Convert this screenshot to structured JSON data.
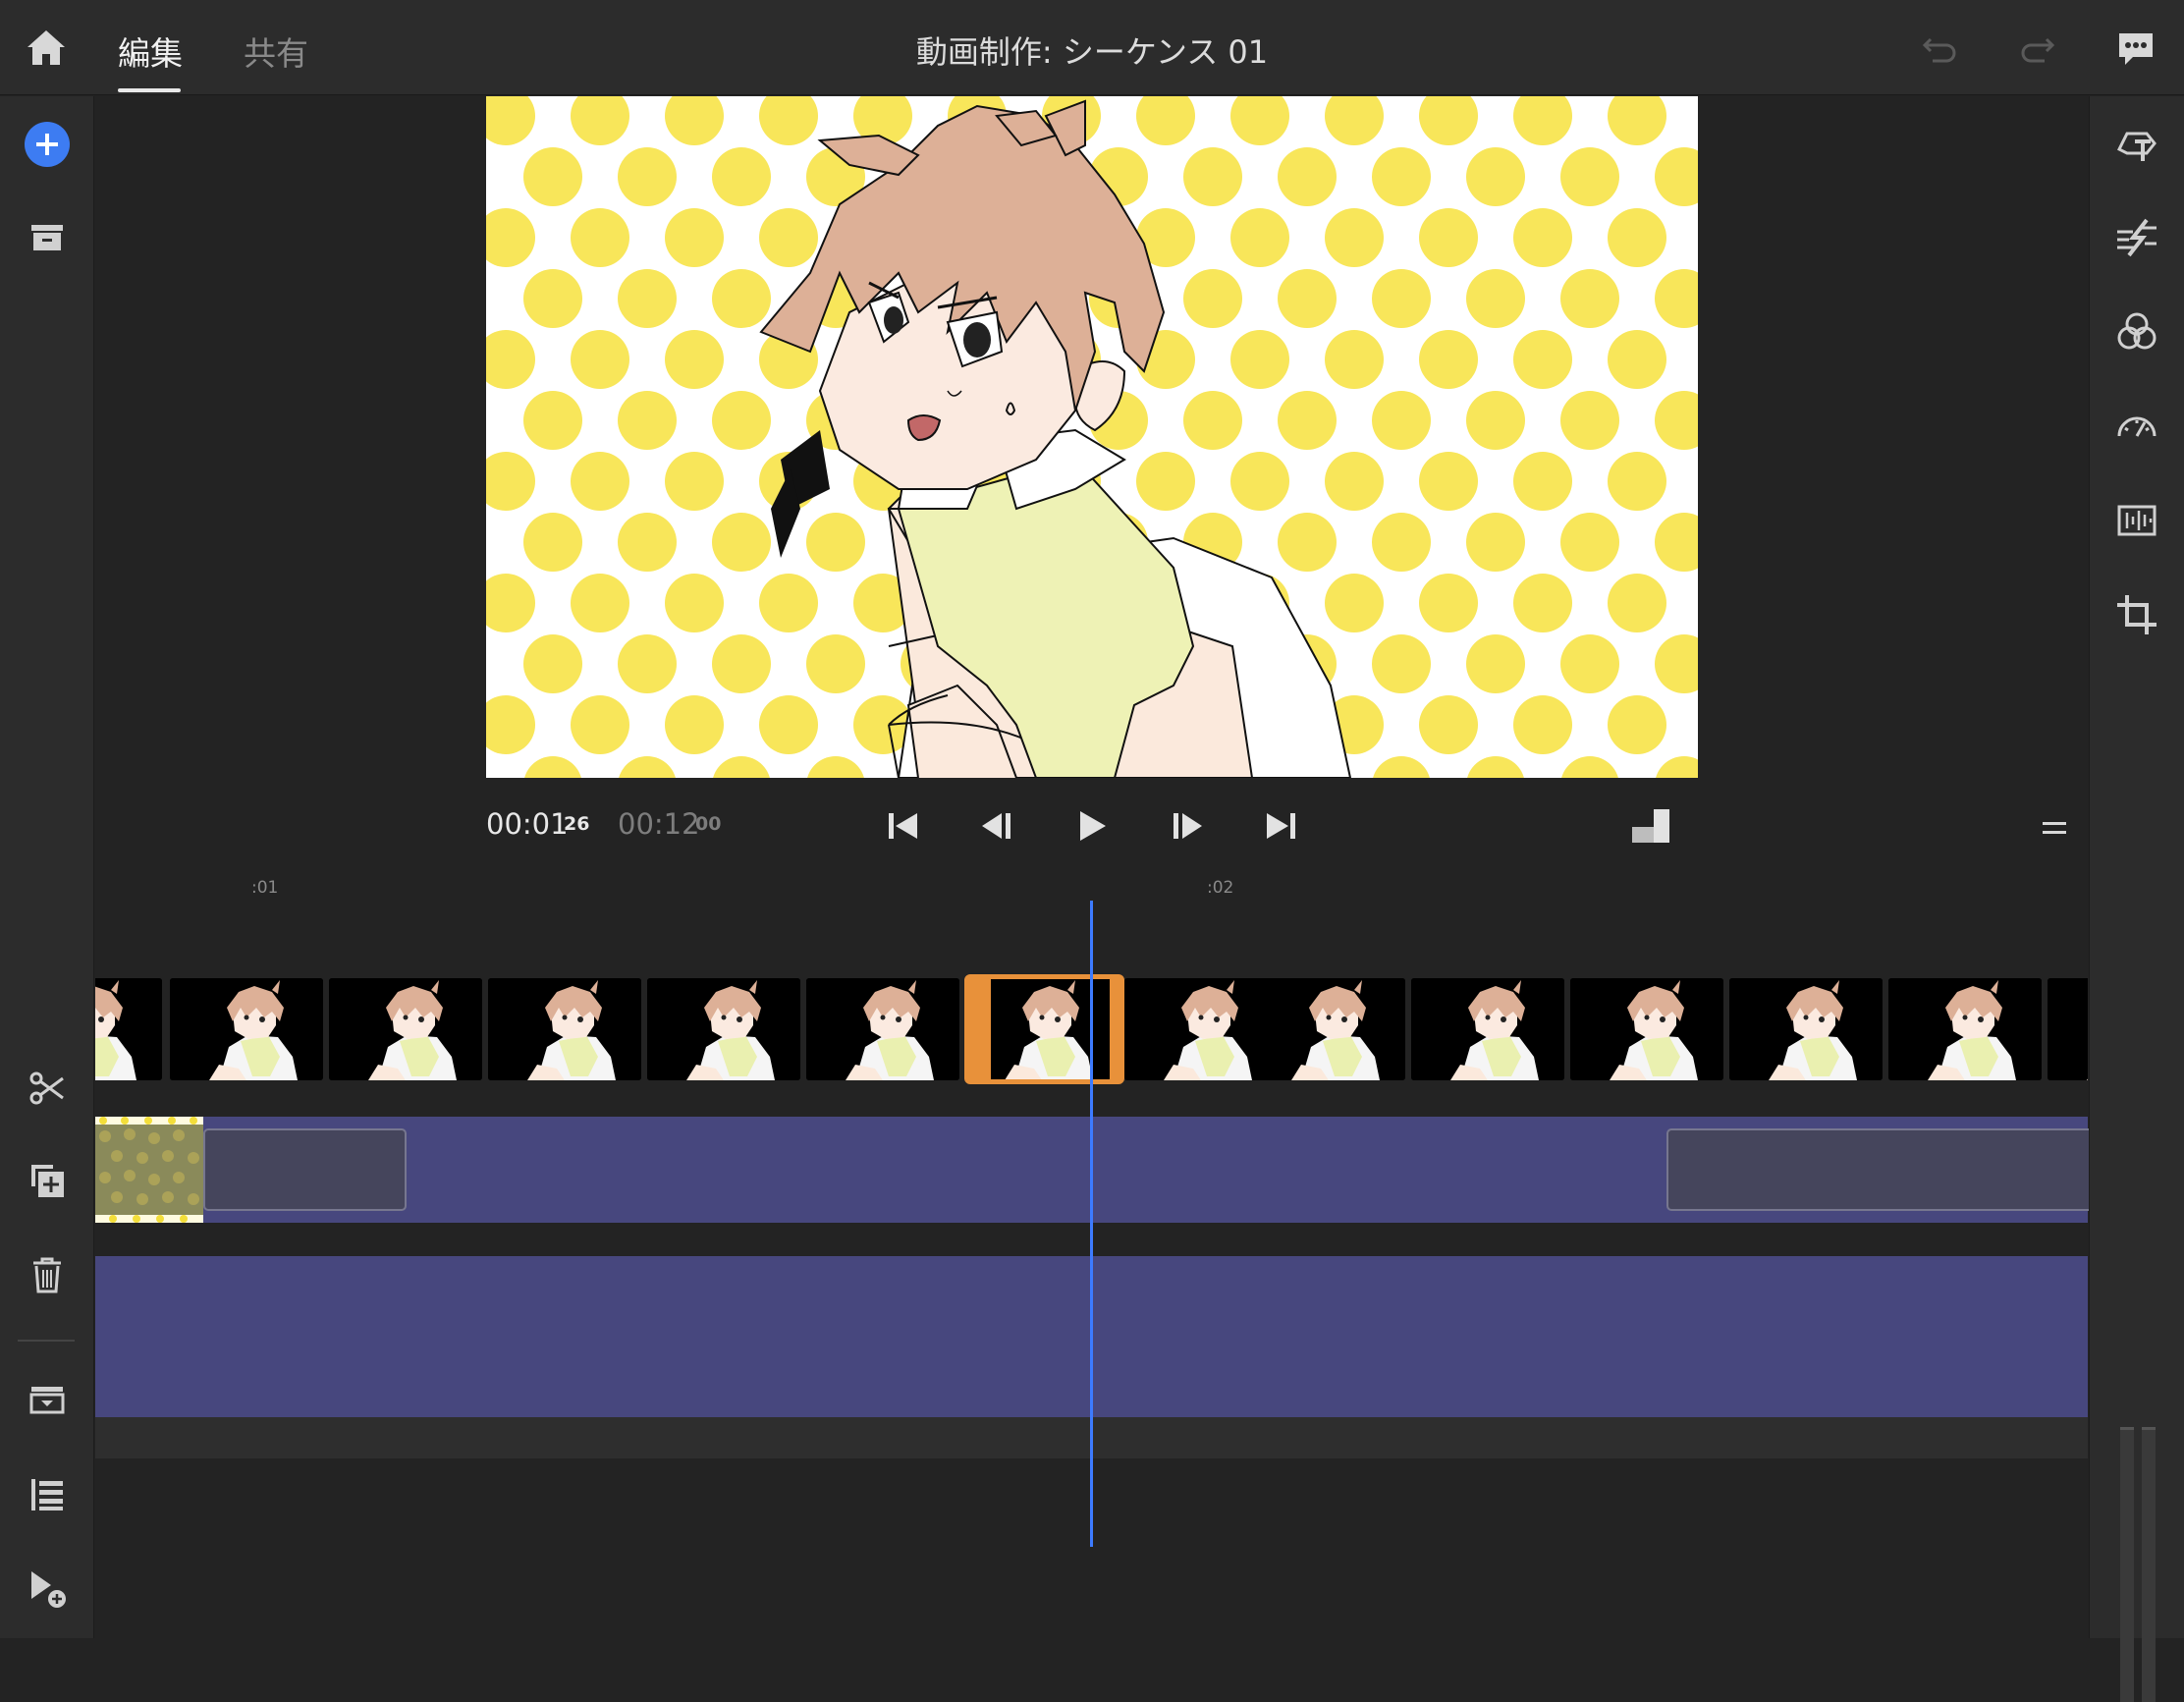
{
  "header": {
    "tabs": [
      {
        "label": "編集",
        "active": true
      },
      {
        "label": "共有",
        "active": false
      }
    ],
    "title": "動画制作: シーケンス 01"
  },
  "transport": {
    "current_time": "00:01",
    "current_frames": "26",
    "total_time": "00:12",
    "total_frames": "00"
  },
  "timeline": {
    "ruler_labels": [
      ":01",
      ":02"
    ]
  },
  "icons": {
    "top_left": "home-icon",
    "top_right": [
      "undo-icon",
      "redo-icon",
      "comment-icon"
    ],
    "left_rail": [
      "add-media-icon",
      "archive-icon",
      "split-scissors-icon",
      "duplicate-icon",
      "delete-icon",
      "track-options-icon",
      "align-icon",
      "add-to-timeline-icon"
    ],
    "right_rail": [
      "title-icon",
      "transitions-icon",
      "color-icon",
      "speed-icon",
      "audio-icon",
      "crop-icon"
    ]
  },
  "colors": {
    "accent": "#3d7bff",
    "add_button": "#3d7cf2",
    "selection": "#e8913a",
    "track_purple": "#47477e",
    "dot_yellow": "#f8e65a"
  }
}
